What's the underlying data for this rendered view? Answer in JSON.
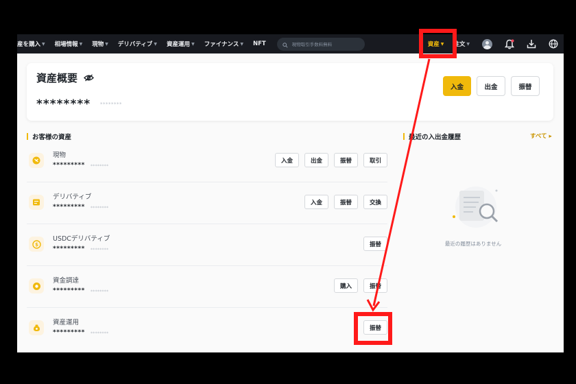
{
  "topnav": {
    "items": [
      "産を購入",
      "相場情報",
      "現物",
      "デリバティブ",
      "資産運用",
      "ファイナンス",
      "NFT"
    ],
    "search_placeholder": "現物取引手数料無料",
    "assets": "資産",
    "orders": "注文"
  },
  "overview": {
    "title": "資産概要",
    "balance": "********",
    "balance_sub": "********",
    "buttons": {
      "deposit": "入金",
      "withdraw": "出金",
      "transfer": "振替"
    }
  },
  "assets_section": {
    "title": "お客様の資産"
  },
  "history_section": {
    "title": "最近の入出金履歴",
    "see_all": "すべて",
    "empty": "最近の履歴はありません"
  },
  "accounts": [
    {
      "name": "現物",
      "balance": "*********",
      "balance_sub": "********",
      "buttons": [
        "入金",
        "出金",
        "振替",
        "取引"
      ]
    },
    {
      "name": "デリバティブ",
      "balance": "*********",
      "balance_sub": "********",
      "buttons": [
        "入金",
        "振替",
        "交換"
      ]
    },
    {
      "name": "USDCデリバティブ",
      "balance": "*********",
      "balance_sub": "********",
      "buttons": [
        "振替"
      ]
    },
    {
      "name": "資金調達",
      "balance": "*********",
      "balance_sub": "********",
      "buttons": [
        "購入",
        "振替"
      ]
    },
    {
      "name": "資産運用",
      "balance": "*********",
      "balance_sub": "********",
      "buttons": [
        "振替"
      ]
    }
  ],
  "colors": {
    "accent": "#f0b90b",
    "nav_bg": "#181a20",
    "annotation": "#ff1a1a"
  },
  "icons": [
    "search-icon",
    "avatar-icon",
    "bell-icon",
    "download-icon",
    "globe-icon",
    "eye-off-icon",
    "spot-icon",
    "derivatives-icon",
    "usdc-icon",
    "funding-icon",
    "earn-icon",
    "empty-history-icon"
  ]
}
